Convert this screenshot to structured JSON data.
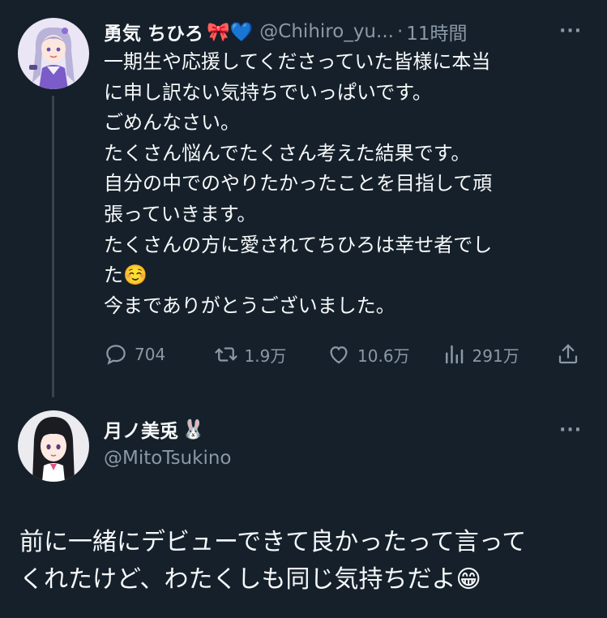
{
  "tweet": {
    "display_name": "勇気 ちひろ",
    "name_emojis": "🎀💙",
    "handle": "@Chihiro_yu...",
    "separator": "·",
    "time": "11時間",
    "more": "···",
    "text_lines": [
      "一期生や応援してくださっていた皆様に本当",
      "に申し訳ない気持ちでいっぱいです。",
      "ごめんなさい。",
      "たくさん悩んでたくさん考えた結果です。",
      "自分の中でのやりたかったことを目指して頑",
      "張っていきます。",
      "たくさんの方に愛されてちひろは幸せ者でし",
      "た☺️",
      "今までありがとうございました。"
    ],
    "replies": "704",
    "retweets": "1.9万",
    "likes": "10.6万",
    "views": "291万"
  },
  "reply_tweet": {
    "display_name": "月ノ美兎",
    "name_emoji": "🐰",
    "handle": "@MitoTsukino",
    "more": "···",
    "text_lines": [
      "前に一緒にデビューできて良かったって言って",
      "くれたけど、わたくしも同じ気持ちだよ😁"
    ]
  },
  "colors": {
    "background": "#15202b",
    "primary_text": "#f7f9f9",
    "secondary_text": "#8b98a5",
    "thread_line": "#38444d"
  }
}
